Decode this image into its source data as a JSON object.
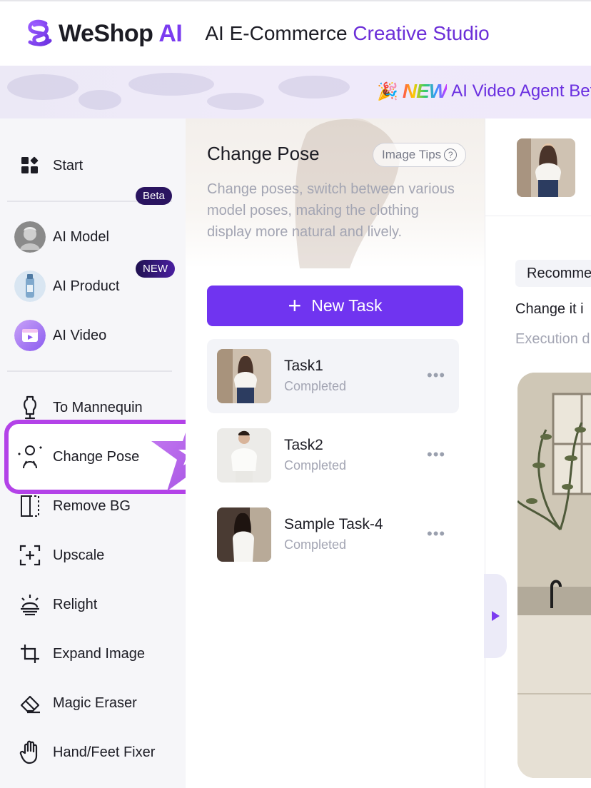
{
  "header": {
    "brand_name": "WeShop",
    "brand_ai": "AI",
    "title_plain": "AI E-Commerce ",
    "title_accent": "Creative Studio"
  },
  "banner": {
    "new_label": "NEW",
    "text": "AI Video Agent Bet"
  },
  "sidebar": {
    "items": [
      {
        "label": "Start",
        "icon": "grid-icon"
      },
      {
        "label": "AI Model",
        "icon": "statue-avatar"
      },
      {
        "label": "AI Product",
        "icon": "bottle-avatar"
      },
      {
        "label": "AI Video",
        "icon": "video-avatar"
      },
      {
        "label": "To Mannequin",
        "icon": "mannequin-icon"
      },
      {
        "label": "Change Pose",
        "icon": "pose-icon"
      },
      {
        "label": "Remove BG",
        "icon": "remove-bg-icon"
      },
      {
        "label": "Upscale",
        "icon": "upscale-icon"
      },
      {
        "label": "Relight",
        "icon": "relight-icon"
      },
      {
        "label": "Expand Image",
        "icon": "crop-icon"
      },
      {
        "label": "Magic Eraser",
        "icon": "eraser-icon"
      },
      {
        "label": "Hand/Feet Fixer",
        "icon": "hand-icon"
      }
    ],
    "beta_badge": "Beta",
    "new_badge": "NEW",
    "accent_color": "#b342e8"
  },
  "panel": {
    "title": "Change Pose",
    "tips_label": "Image Tips",
    "description": "Change poses, switch between various model poses, making the clothing display more natural and lively.",
    "new_task_label": "New Task",
    "tasks": [
      {
        "name": "Task1",
        "status": "Completed"
      },
      {
        "name": "Task2",
        "status": "Completed"
      },
      {
        "name": "Sample Task-4",
        "status": "Completed"
      }
    ]
  },
  "right": {
    "recommend_label": "Recommen",
    "change_text": "Change it i",
    "execution_text": "Execution d"
  },
  "colors": {
    "primary": "#7034f0",
    "brand": "#7b3cf0"
  }
}
